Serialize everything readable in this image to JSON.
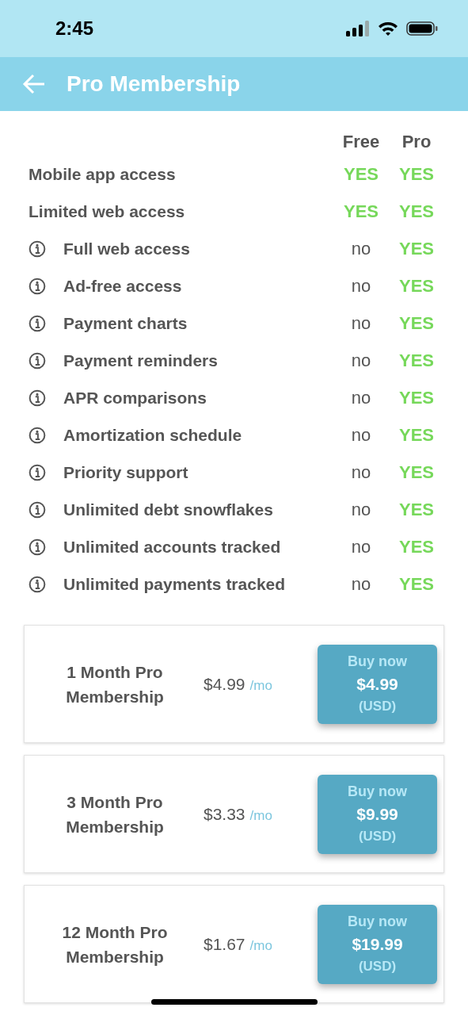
{
  "status_bar": {
    "time": "2:45"
  },
  "header": {
    "title": "Pro Membership"
  },
  "comparison": {
    "columns": [
      "Free",
      "Pro"
    ],
    "features": [
      {
        "name": "Mobile app access",
        "info": false,
        "free": {
          "text": "YES",
          "included": true
        },
        "pro": {
          "text": "YES",
          "included": true
        }
      },
      {
        "name": "Limited web access",
        "info": false,
        "free": {
          "text": "YES",
          "included": true
        },
        "pro": {
          "text": "YES",
          "included": true
        }
      },
      {
        "name": "Full web access",
        "info": true,
        "free": {
          "text": "no",
          "included": false
        },
        "pro": {
          "text": "YES",
          "included": true
        }
      },
      {
        "name": "Ad-free access",
        "info": true,
        "free": {
          "text": "no",
          "included": false
        },
        "pro": {
          "text": "YES",
          "included": true
        }
      },
      {
        "name": "Payment charts",
        "info": true,
        "free": {
          "text": "no",
          "included": false
        },
        "pro": {
          "text": "YES",
          "included": true
        }
      },
      {
        "name": "Payment reminders",
        "info": true,
        "free": {
          "text": "no",
          "included": false
        },
        "pro": {
          "text": "YES",
          "included": true
        }
      },
      {
        "name": "APR comparisons",
        "info": true,
        "free": {
          "text": "no",
          "included": false
        },
        "pro": {
          "text": "YES",
          "included": true
        }
      },
      {
        "name": "Amortization schedule",
        "info": true,
        "free": {
          "text": "no",
          "included": false
        },
        "pro": {
          "text": "YES",
          "included": true
        }
      },
      {
        "name": "Priority support",
        "info": true,
        "free": {
          "text": "no",
          "included": false
        },
        "pro": {
          "text": "YES",
          "included": true
        }
      },
      {
        "name": "Unlimited debt snowflakes",
        "info": true,
        "free": {
          "text": "no",
          "included": false
        },
        "pro": {
          "text": "YES",
          "included": true
        }
      },
      {
        "name": "Unlimited accounts tracked",
        "info": true,
        "free": {
          "text": "no",
          "included": false
        },
        "pro": {
          "text": "YES",
          "included": true
        }
      },
      {
        "name": "Unlimited payments tracked",
        "info": true,
        "free": {
          "text": "no",
          "included": false
        },
        "pro": {
          "text": "YES",
          "included": true
        }
      }
    ]
  },
  "plans": [
    {
      "name": "1 Month Pro Membership",
      "monthly_price": "$4.99",
      "per": "/mo",
      "button": {
        "label": "Buy now",
        "price": "$4.99",
        "currency": "(USD)"
      }
    },
    {
      "name": "3 Month Pro Membership",
      "monthly_price": "$3.33",
      "per": "/mo",
      "button": {
        "label": "Buy now",
        "price": "$9.99",
        "currency": "(USD)"
      }
    },
    {
      "name": "12 Month Pro Membership",
      "monthly_price": "$1.67",
      "per": "/mo",
      "button": {
        "label": "Buy now",
        "price": "$19.99",
        "currency": "(USD)"
      }
    }
  ]
}
